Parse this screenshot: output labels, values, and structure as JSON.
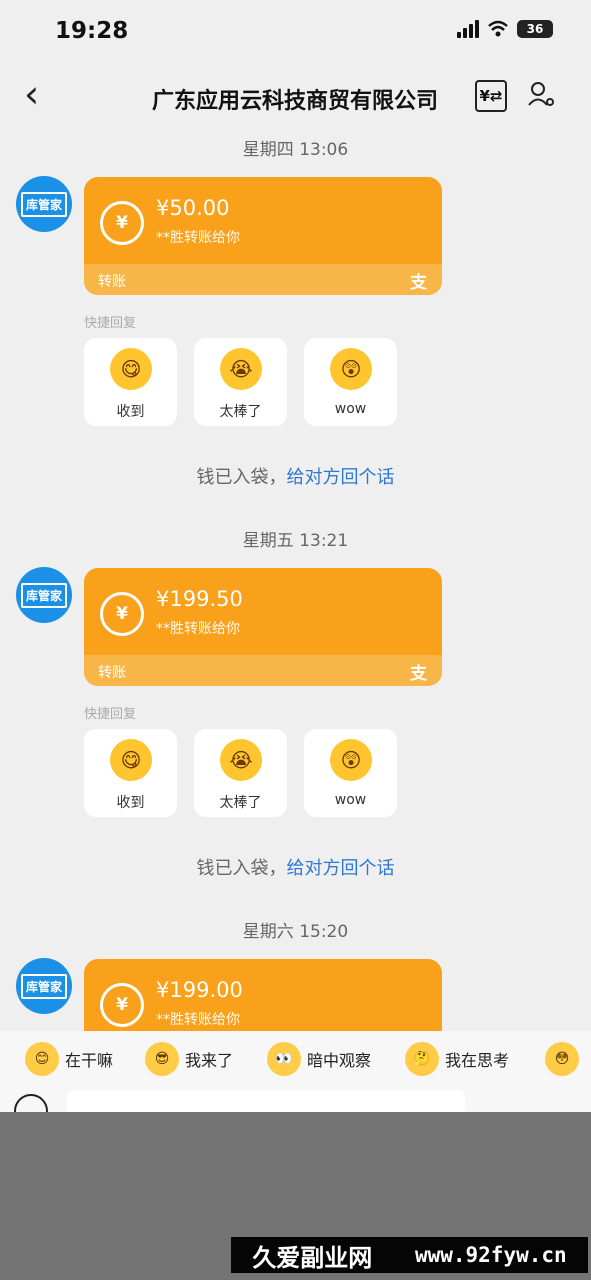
{
  "status": {
    "time": "19:28",
    "battery": "36"
  },
  "nav": {
    "back": "‹",
    "title": "广东应用云科技商贸有限公司",
    "money_icon": "¥⇄"
  },
  "messages": [
    {
      "date": "星期四 13:06",
      "avatar": "库管家",
      "amount": "¥50.00",
      "sender": "**胜转账给你",
      "transfer": "转账",
      "pay_icon": "支"
    },
    {
      "date": "星期五 13:21",
      "avatar": "库管家",
      "amount": "¥199.50",
      "sender": "**胜转账给你",
      "transfer": "转账",
      "pay_icon": "支"
    },
    {
      "date": "星期六 15:20",
      "avatar": "库管家",
      "amount": "¥199.00",
      "sender": "**胜转账给你"
    }
  ],
  "quick_reply": {
    "label": "快捷回复",
    "items": [
      {
        "label": "收到",
        "emoji": "😋"
      },
      {
        "label": "太棒了",
        "emoji": "😭"
      },
      {
        "label": "wow",
        "emoji": "😲"
      }
    ]
  },
  "received": {
    "text": "钱已入袋，",
    "link": "给对方回个话"
  },
  "stickers": [
    {
      "label": "在干嘛",
      "emoji": "😊"
    },
    {
      "label": "我来了",
      "emoji": "😎"
    },
    {
      "label": "暗中观察",
      "emoji": "👀"
    },
    {
      "label": "我在思考",
      "emoji": "🤔"
    }
  ],
  "watermark": {
    "brand": "久爱副业网",
    "domain": "www.92fyw.cn"
  }
}
